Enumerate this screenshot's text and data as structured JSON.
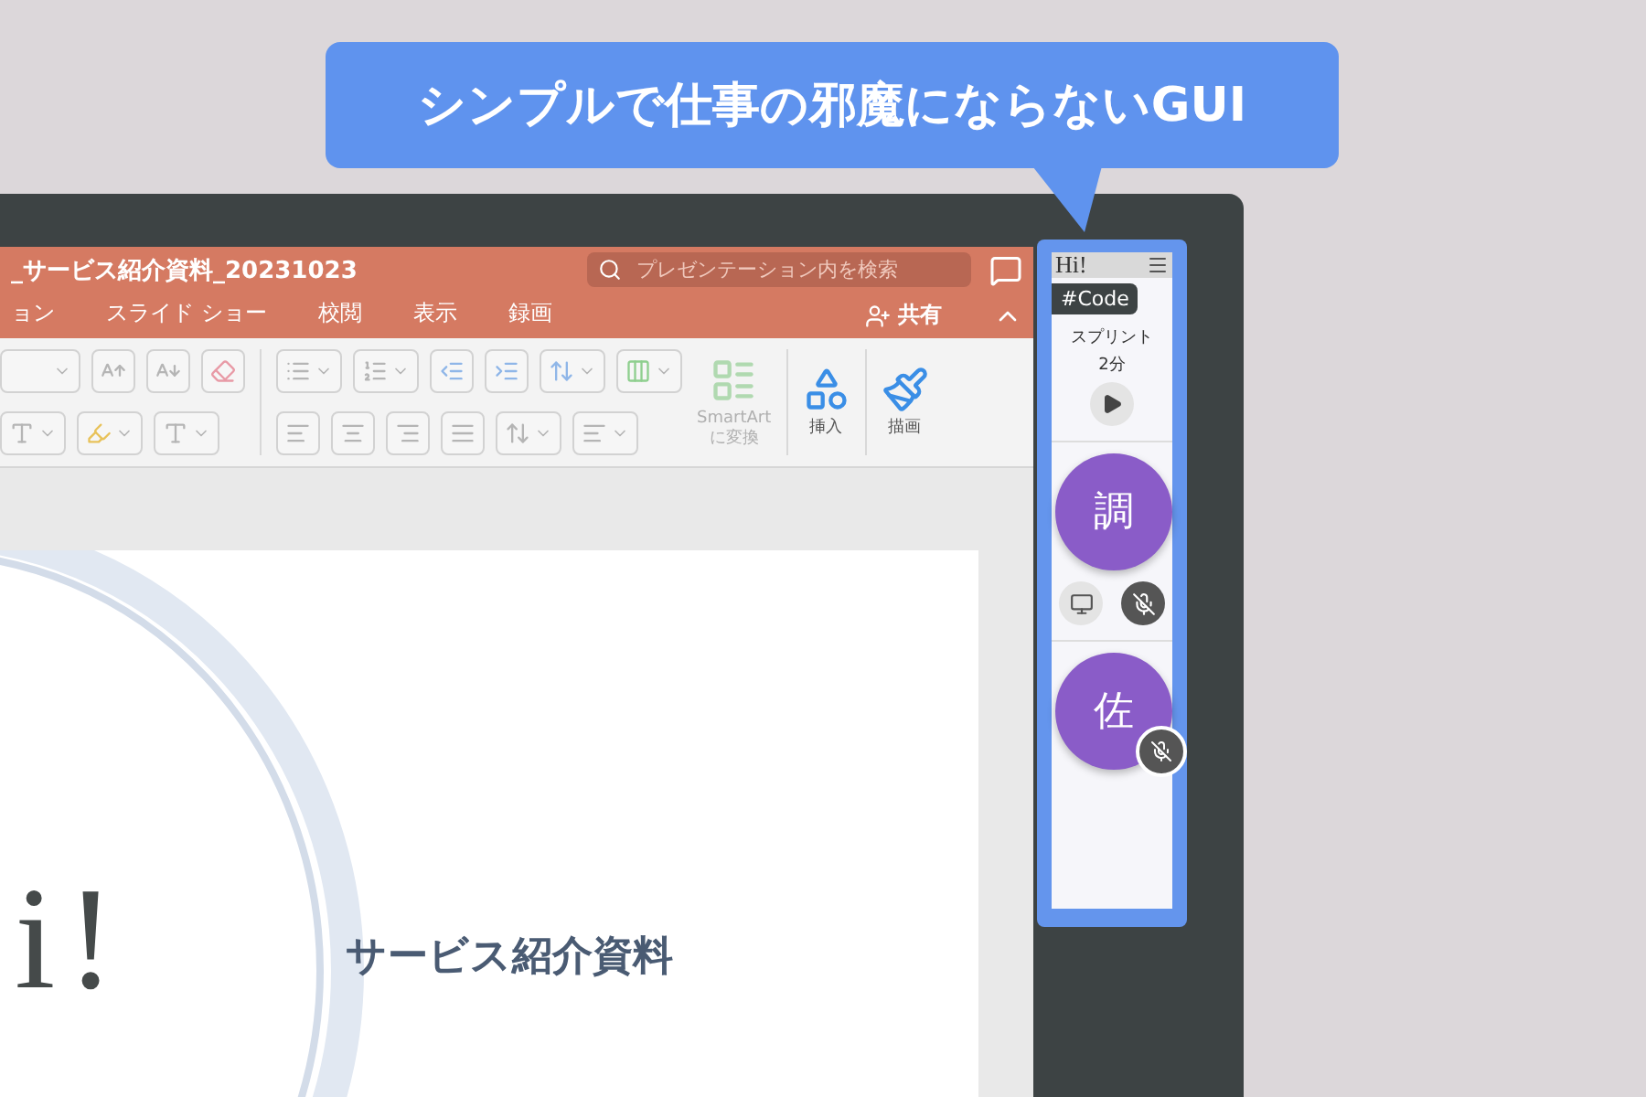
{
  "callout": {
    "text": "シンプルで仕事の邪魔にならないGUI"
  },
  "app": {
    "title": "_サービス紹介資料_20231023",
    "search": {
      "placeholder": "プレゼンテーション内を検索"
    },
    "tabs": [
      {
        "label": "ョン",
        "selected": false
      },
      {
        "label": "スライド ショー",
        "selected": false
      },
      {
        "label": "校閲",
        "selected": false
      },
      {
        "label": "表示",
        "selected": false
      },
      {
        "label": "録画",
        "selected": false
      }
    ],
    "share": "共有",
    "ribbon_buttons": [
      {
        "label": "SmartArt\nに変換",
        "kind": "smartart",
        "disabled": true
      },
      {
        "label": "挿入",
        "kind": "insert",
        "disabled": false
      },
      {
        "label": "描画",
        "kind": "draw",
        "disabled": false
      }
    ]
  },
  "slide": {
    "logo": "i!",
    "title": "サービス紹介資料"
  },
  "widget": {
    "logo": "Hi!",
    "channel": "#Code",
    "timer_label": "スプリント",
    "timer_value": "2分",
    "mic_muted": true,
    "members": [
      {
        "initial": "調",
        "muted": false
      },
      {
        "initial": "佐",
        "muted": true
      }
    ]
  }
}
